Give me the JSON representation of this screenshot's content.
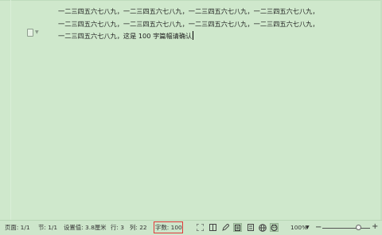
{
  "document": {
    "lines": [
      "一二三四五六七八九，一二三四五六七八九，一二三四五六七八九，一二三四五六七八九，",
      "一二三四五六七八九，一二三四五六七八九，一二三四五六七八九，一二三四五六七八九，",
      "一二三四五六七八九，这是 100 字篇幅请确认"
    ]
  },
  "status_bar": {
    "page": "页面: 1/1",
    "section": "节: 1/1",
    "setting": "设置值: 3.8厘米",
    "row": "行: 3",
    "column": "列: 22",
    "word_count": "字数: 100",
    "zoom": "100%",
    "zoom_level": 0.75
  },
  "colors": {
    "page_background": "#cfe8cc",
    "highlight_box": "#e03a3a"
  },
  "icons": {
    "view_modes": [
      "fullscreen-icon",
      "reading-mode-icon",
      "edit-pen-icon",
      "page-view-icon",
      "outline-view-icon",
      "web-view-icon",
      "eye-protection-icon"
    ]
  }
}
